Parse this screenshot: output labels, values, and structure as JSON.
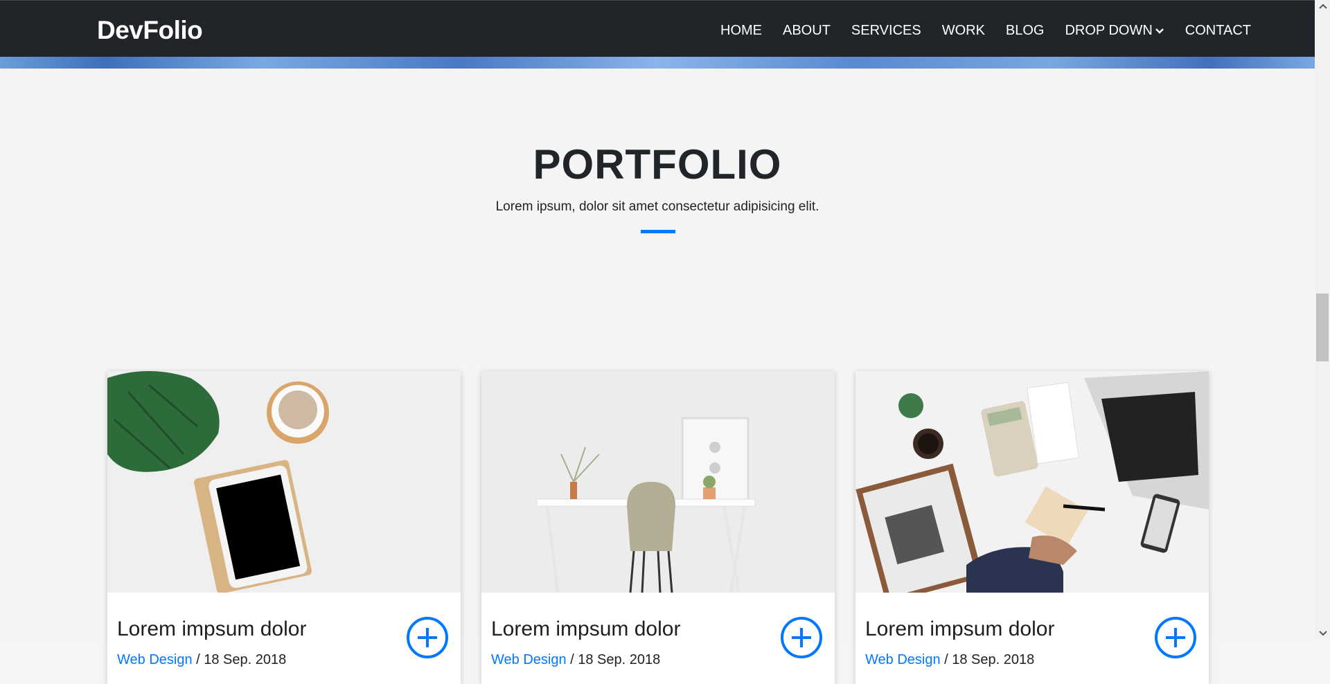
{
  "nav": {
    "brand": "DevFolio",
    "items": [
      "HOME",
      "ABOUT",
      "SERVICES",
      "WORK",
      "BLOG",
      "DROP DOWN",
      "CONTACT"
    ]
  },
  "section": {
    "title": "PORTFOLIO",
    "subtitle": "Lorem ipsum, dolor sit amet consectetur adipisicing elit."
  },
  "cards": [
    {
      "title": "Lorem impsum dolor",
      "category": "Web Design",
      "date": " / 18 Sep. 2018",
      "image": "desk-flatlay-tablet-plant"
    },
    {
      "title": "Lorem impsum dolor",
      "category": "Web Design",
      "date": " / 18 Sep. 2018",
      "image": "white-desk-chair"
    },
    {
      "title": "Lorem impsum dolor",
      "category": "Web Design",
      "date": " / 18 Sep. 2018",
      "image": "business-desk-laptop-newspaper"
    }
  ],
  "colors": {
    "accent": "#0078ff",
    "navbar": "#212529",
    "background": "#f4f4f5"
  }
}
